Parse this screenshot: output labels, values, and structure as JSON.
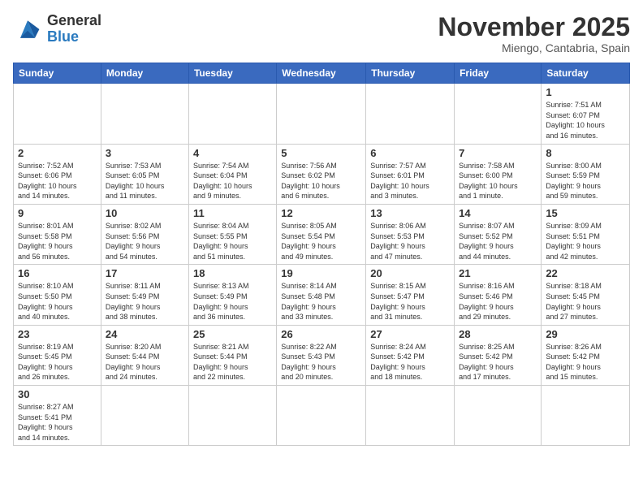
{
  "logo": {
    "text_general": "General",
    "text_blue": "Blue"
  },
  "header": {
    "month": "November 2025",
    "location": "Miengo, Cantabria, Spain"
  },
  "weekdays": [
    "Sunday",
    "Monday",
    "Tuesday",
    "Wednesday",
    "Thursday",
    "Friday",
    "Saturday"
  ],
  "weeks": [
    [
      {
        "day": "",
        "info": ""
      },
      {
        "day": "",
        "info": ""
      },
      {
        "day": "",
        "info": ""
      },
      {
        "day": "",
        "info": ""
      },
      {
        "day": "",
        "info": ""
      },
      {
        "day": "",
        "info": ""
      },
      {
        "day": "1",
        "info": "Sunrise: 7:51 AM\nSunset: 6:07 PM\nDaylight: 10 hours\nand 16 minutes."
      }
    ],
    [
      {
        "day": "2",
        "info": "Sunrise: 7:52 AM\nSunset: 6:06 PM\nDaylight: 10 hours\nand 14 minutes."
      },
      {
        "day": "3",
        "info": "Sunrise: 7:53 AM\nSunset: 6:05 PM\nDaylight: 10 hours\nand 11 minutes."
      },
      {
        "day": "4",
        "info": "Sunrise: 7:54 AM\nSunset: 6:04 PM\nDaylight: 10 hours\nand 9 minutes."
      },
      {
        "day": "5",
        "info": "Sunrise: 7:56 AM\nSunset: 6:02 PM\nDaylight: 10 hours\nand 6 minutes."
      },
      {
        "day": "6",
        "info": "Sunrise: 7:57 AM\nSunset: 6:01 PM\nDaylight: 10 hours\nand 3 minutes."
      },
      {
        "day": "7",
        "info": "Sunrise: 7:58 AM\nSunset: 6:00 PM\nDaylight: 10 hours\nand 1 minute."
      },
      {
        "day": "8",
        "info": "Sunrise: 8:00 AM\nSunset: 5:59 PM\nDaylight: 9 hours\nand 59 minutes."
      }
    ],
    [
      {
        "day": "9",
        "info": "Sunrise: 8:01 AM\nSunset: 5:58 PM\nDaylight: 9 hours\nand 56 minutes."
      },
      {
        "day": "10",
        "info": "Sunrise: 8:02 AM\nSunset: 5:56 PM\nDaylight: 9 hours\nand 54 minutes."
      },
      {
        "day": "11",
        "info": "Sunrise: 8:04 AM\nSunset: 5:55 PM\nDaylight: 9 hours\nand 51 minutes."
      },
      {
        "day": "12",
        "info": "Sunrise: 8:05 AM\nSunset: 5:54 PM\nDaylight: 9 hours\nand 49 minutes."
      },
      {
        "day": "13",
        "info": "Sunrise: 8:06 AM\nSunset: 5:53 PM\nDaylight: 9 hours\nand 47 minutes."
      },
      {
        "day": "14",
        "info": "Sunrise: 8:07 AM\nSunset: 5:52 PM\nDaylight: 9 hours\nand 44 minutes."
      },
      {
        "day": "15",
        "info": "Sunrise: 8:09 AM\nSunset: 5:51 PM\nDaylight: 9 hours\nand 42 minutes."
      }
    ],
    [
      {
        "day": "16",
        "info": "Sunrise: 8:10 AM\nSunset: 5:50 PM\nDaylight: 9 hours\nand 40 minutes."
      },
      {
        "day": "17",
        "info": "Sunrise: 8:11 AM\nSunset: 5:49 PM\nDaylight: 9 hours\nand 38 minutes."
      },
      {
        "day": "18",
        "info": "Sunrise: 8:13 AM\nSunset: 5:49 PM\nDaylight: 9 hours\nand 36 minutes."
      },
      {
        "day": "19",
        "info": "Sunrise: 8:14 AM\nSunset: 5:48 PM\nDaylight: 9 hours\nand 33 minutes."
      },
      {
        "day": "20",
        "info": "Sunrise: 8:15 AM\nSunset: 5:47 PM\nDaylight: 9 hours\nand 31 minutes."
      },
      {
        "day": "21",
        "info": "Sunrise: 8:16 AM\nSunset: 5:46 PM\nDaylight: 9 hours\nand 29 minutes."
      },
      {
        "day": "22",
        "info": "Sunrise: 8:18 AM\nSunset: 5:45 PM\nDaylight: 9 hours\nand 27 minutes."
      }
    ],
    [
      {
        "day": "23",
        "info": "Sunrise: 8:19 AM\nSunset: 5:45 PM\nDaylight: 9 hours\nand 26 minutes."
      },
      {
        "day": "24",
        "info": "Sunrise: 8:20 AM\nSunset: 5:44 PM\nDaylight: 9 hours\nand 24 minutes."
      },
      {
        "day": "25",
        "info": "Sunrise: 8:21 AM\nSunset: 5:44 PM\nDaylight: 9 hours\nand 22 minutes."
      },
      {
        "day": "26",
        "info": "Sunrise: 8:22 AM\nSunset: 5:43 PM\nDaylight: 9 hours\nand 20 minutes."
      },
      {
        "day": "27",
        "info": "Sunrise: 8:24 AM\nSunset: 5:42 PM\nDaylight: 9 hours\nand 18 minutes."
      },
      {
        "day": "28",
        "info": "Sunrise: 8:25 AM\nSunset: 5:42 PM\nDaylight: 9 hours\nand 17 minutes."
      },
      {
        "day": "29",
        "info": "Sunrise: 8:26 AM\nSunset: 5:42 PM\nDaylight: 9 hours\nand 15 minutes."
      }
    ],
    [
      {
        "day": "30",
        "info": "Sunrise: 8:27 AM\nSunset: 5:41 PM\nDaylight: 9 hours\nand 14 minutes."
      },
      {
        "day": "",
        "info": ""
      },
      {
        "day": "",
        "info": ""
      },
      {
        "day": "",
        "info": ""
      },
      {
        "day": "",
        "info": ""
      },
      {
        "day": "",
        "info": ""
      },
      {
        "day": "",
        "info": ""
      }
    ]
  ]
}
